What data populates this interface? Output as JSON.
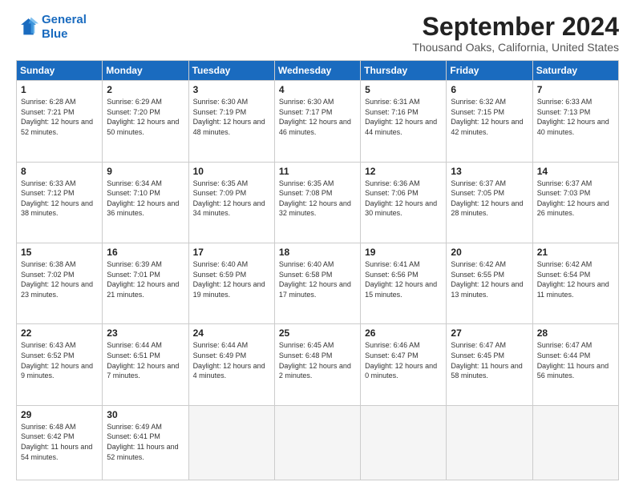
{
  "logo": {
    "line1": "General",
    "line2": "Blue"
  },
  "title": "September 2024",
  "subtitle": "Thousand Oaks, California, United States",
  "days_header": [
    "Sunday",
    "Monday",
    "Tuesday",
    "Wednesday",
    "Thursday",
    "Friday",
    "Saturday"
  ],
  "weeks": [
    [
      {
        "day": "1",
        "sunrise": "6:28 AM",
        "sunset": "7:21 PM",
        "daylight": "12 hours and 52 minutes."
      },
      {
        "day": "2",
        "sunrise": "6:29 AM",
        "sunset": "7:20 PM",
        "daylight": "12 hours and 50 minutes."
      },
      {
        "day": "3",
        "sunrise": "6:30 AM",
        "sunset": "7:19 PM",
        "daylight": "12 hours and 48 minutes."
      },
      {
        "day": "4",
        "sunrise": "6:30 AM",
        "sunset": "7:17 PM",
        "daylight": "12 hours and 46 minutes."
      },
      {
        "day": "5",
        "sunrise": "6:31 AM",
        "sunset": "7:16 PM",
        "daylight": "12 hours and 44 minutes."
      },
      {
        "day": "6",
        "sunrise": "6:32 AM",
        "sunset": "7:15 PM",
        "daylight": "12 hours and 42 minutes."
      },
      {
        "day": "7",
        "sunrise": "6:33 AM",
        "sunset": "7:13 PM",
        "daylight": "12 hours and 40 minutes."
      }
    ],
    [
      {
        "day": "8",
        "sunrise": "6:33 AM",
        "sunset": "7:12 PM",
        "daylight": "12 hours and 38 minutes."
      },
      {
        "day": "9",
        "sunrise": "6:34 AM",
        "sunset": "7:10 PM",
        "daylight": "12 hours and 36 minutes."
      },
      {
        "day": "10",
        "sunrise": "6:35 AM",
        "sunset": "7:09 PM",
        "daylight": "12 hours and 34 minutes."
      },
      {
        "day": "11",
        "sunrise": "6:35 AM",
        "sunset": "7:08 PM",
        "daylight": "12 hours and 32 minutes."
      },
      {
        "day": "12",
        "sunrise": "6:36 AM",
        "sunset": "7:06 PM",
        "daylight": "12 hours and 30 minutes."
      },
      {
        "day": "13",
        "sunrise": "6:37 AM",
        "sunset": "7:05 PM",
        "daylight": "12 hours and 28 minutes."
      },
      {
        "day": "14",
        "sunrise": "6:37 AM",
        "sunset": "7:03 PM",
        "daylight": "12 hours and 26 minutes."
      }
    ],
    [
      {
        "day": "15",
        "sunrise": "6:38 AM",
        "sunset": "7:02 PM",
        "daylight": "12 hours and 23 minutes."
      },
      {
        "day": "16",
        "sunrise": "6:39 AM",
        "sunset": "7:01 PM",
        "daylight": "12 hours and 21 minutes."
      },
      {
        "day": "17",
        "sunrise": "6:40 AM",
        "sunset": "6:59 PM",
        "daylight": "12 hours and 19 minutes."
      },
      {
        "day": "18",
        "sunrise": "6:40 AM",
        "sunset": "6:58 PM",
        "daylight": "12 hours and 17 minutes."
      },
      {
        "day": "19",
        "sunrise": "6:41 AM",
        "sunset": "6:56 PM",
        "daylight": "12 hours and 15 minutes."
      },
      {
        "day": "20",
        "sunrise": "6:42 AM",
        "sunset": "6:55 PM",
        "daylight": "12 hours and 13 minutes."
      },
      {
        "day": "21",
        "sunrise": "6:42 AM",
        "sunset": "6:54 PM",
        "daylight": "12 hours and 11 minutes."
      }
    ],
    [
      {
        "day": "22",
        "sunrise": "6:43 AM",
        "sunset": "6:52 PM",
        "daylight": "12 hours and 9 minutes."
      },
      {
        "day": "23",
        "sunrise": "6:44 AM",
        "sunset": "6:51 PM",
        "daylight": "12 hours and 7 minutes."
      },
      {
        "day": "24",
        "sunrise": "6:44 AM",
        "sunset": "6:49 PM",
        "daylight": "12 hours and 4 minutes."
      },
      {
        "day": "25",
        "sunrise": "6:45 AM",
        "sunset": "6:48 PM",
        "daylight": "12 hours and 2 minutes."
      },
      {
        "day": "26",
        "sunrise": "6:46 AM",
        "sunset": "6:47 PM",
        "daylight": "12 hours and 0 minutes."
      },
      {
        "day": "27",
        "sunrise": "6:47 AM",
        "sunset": "6:45 PM",
        "daylight": "11 hours and 58 minutes."
      },
      {
        "day": "28",
        "sunrise": "6:47 AM",
        "sunset": "6:44 PM",
        "daylight": "11 hours and 56 minutes."
      }
    ],
    [
      {
        "day": "29",
        "sunrise": "6:48 AM",
        "sunset": "6:42 PM",
        "daylight": "11 hours and 54 minutes."
      },
      {
        "day": "30",
        "sunrise": "6:49 AM",
        "sunset": "6:41 PM",
        "daylight": "11 hours and 52 minutes."
      },
      null,
      null,
      null,
      null,
      null
    ]
  ]
}
